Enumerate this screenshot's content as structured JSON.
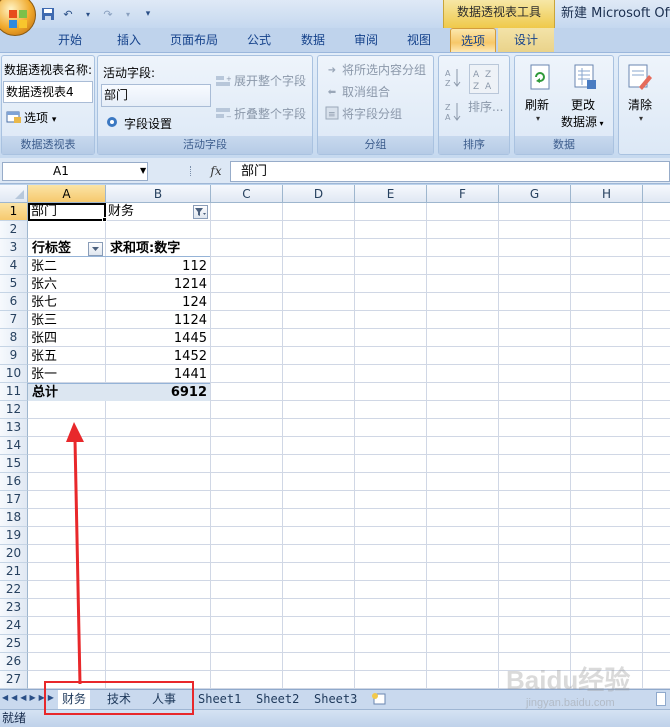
{
  "title": {
    "context_tool": "数据透视表工具",
    "app": "新建 Microsoft Office"
  },
  "tabs": [
    "开始",
    "插入",
    "页面布局",
    "公式",
    "数据",
    "审阅",
    "视图",
    "选项",
    "设计"
  ],
  "active_tab": "选项",
  "ribbon": {
    "pivot": {
      "name_label": "数据透视表名称:",
      "name_value": "数据透视表4",
      "options_label": "选项",
      "group_label": "数据透视表"
    },
    "active_field": {
      "label": "活动字段:",
      "value": "部门",
      "field_settings": "字段设置",
      "expand": "展开整个字段",
      "collapse": "折叠整个字段",
      "group_label": "活动字段"
    },
    "grouping": {
      "group_selection": "将所选内容分组",
      "ungroup": "取消组合",
      "group_field": "将字段分组",
      "group_label": "分组"
    },
    "sort": {
      "sort_label": "排序...",
      "group_label": "排序"
    },
    "data": {
      "refresh": "刷新",
      "change_source_1": "更改",
      "change_source_2": "数据源",
      "group_label": "数据"
    },
    "clear": {
      "label": "清除"
    }
  },
  "formula_bar": {
    "name_box": "A1",
    "fx": "fx",
    "content": "部门"
  },
  "columns": [
    "A",
    "B",
    "C",
    "D",
    "E",
    "F",
    "G",
    "H"
  ],
  "rows": [
    "1",
    "2",
    "3",
    "4",
    "5",
    "6",
    "7",
    "8",
    "9",
    "10",
    "11",
    "12",
    "13",
    "14",
    "15",
    "16",
    "17",
    "18",
    "19",
    "20",
    "21",
    "22",
    "23",
    "24",
    "25",
    "26",
    "27"
  ],
  "cells": {
    "a1": "部门",
    "b1": "财务",
    "a3": "行标签",
    "b3": "求和项:数字",
    "data_rows": [
      {
        "name": "张二",
        "value": "112"
      },
      {
        "name": "张六",
        "value": "1214"
      },
      {
        "name": "张七",
        "value": "124"
      },
      {
        "name": "张三",
        "value": "1124"
      },
      {
        "name": "张四",
        "value": "1445"
      },
      {
        "name": "张五",
        "value": "1452"
      },
      {
        "name": "张一",
        "value": "1441"
      }
    ],
    "total_label": "总计",
    "total_value": "6912"
  },
  "sheet_tabs": [
    "财务",
    "技术",
    "人事",
    "Sheet1",
    "Sheet2",
    "Sheet3"
  ],
  "active_sheet": "财务",
  "status": "就绪",
  "watermark": {
    "main": "Baidu经验",
    "sub": "jingyan.baidu.com"
  }
}
